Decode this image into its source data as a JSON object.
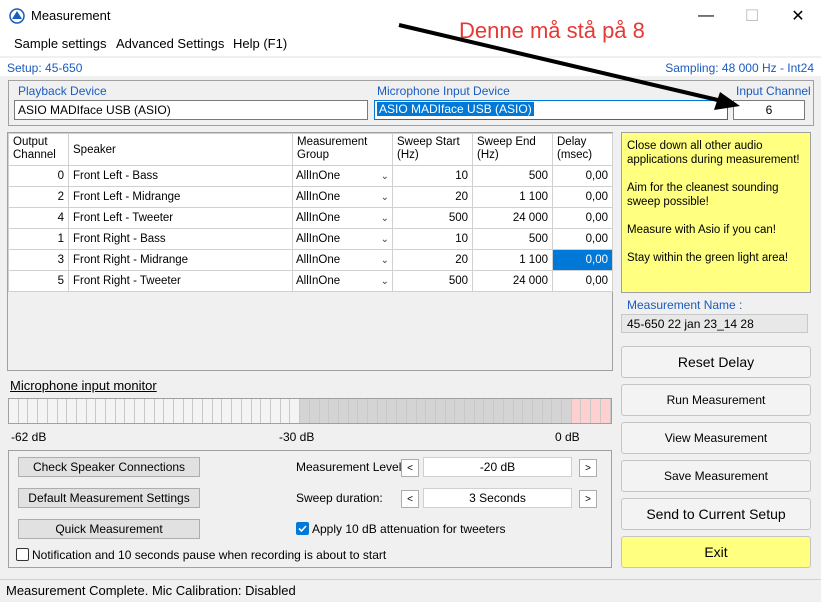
{
  "window": {
    "title": "Measurement",
    "minimize": "—",
    "maximize": "☐",
    "close": "✕"
  },
  "menu": [
    "Sample settings",
    "Advanced Settings",
    "Help (F1)"
  ],
  "setup": {
    "left": "Setup: 45-650",
    "right": "Sampling: 48 000 Hz - Int24"
  },
  "playback": {
    "label": "Playback Device",
    "value": "ASIO MADIface USB (ASIO)"
  },
  "microphone": {
    "label": "Microphone Input Device",
    "value": "ASIO MADIface USB (ASIO)"
  },
  "input_channel": {
    "label": "Input Channel",
    "value": "6"
  },
  "annotation": "Denne må stå på 8",
  "table": {
    "headers": [
      "Output\nChannel",
      "Speaker",
      "Measurement\nGroup",
      "Sweep Start\n(Hz)",
      "Sweep End\n(Hz)",
      "Delay\n(msec)"
    ],
    "rows": [
      [
        "0",
        "Front Left - Bass",
        "AllInOne",
        "10",
        "500",
        "0,00"
      ],
      [
        "2",
        "Front Left - Midrange",
        "AllInOne",
        "20",
        "1 100",
        "0,00"
      ],
      [
        "4",
        "Front Left - Tweeter",
        "AllInOne",
        "500",
        "24 000",
        "0,00"
      ],
      [
        "1",
        "Front Right - Bass",
        "AllInOne",
        "10",
        "500",
        "0,00"
      ],
      [
        "3",
        "Front Right - Midrange",
        "AllInOne",
        "20",
        "1 100",
        "0,00"
      ],
      [
        "5",
        "Front Right - Tweeter",
        "AllInOne",
        "500",
        "24 000",
        "0,00"
      ]
    ]
  },
  "tips": [
    "Close down all other audio applications during measurement!",
    "Aim for the cleanest sounding sweep possible!",
    "Measure with Asio if you can!",
    "Stay within the green light area!"
  ],
  "measurement_name": {
    "label": "Measurement Name :",
    "value": "45-650 22 jan 23_14 28"
  },
  "right_buttons": [
    "Reset Delay",
    "Run Measurement",
    "View Measurement",
    "Save Measurement",
    "Send to Current Setup",
    "Exit"
  ],
  "mic_monitor": {
    "label": "Microphone input monitor",
    "scale": [
      "-62 dB",
      "-30 dB",
      "0 dB"
    ]
  },
  "lower": {
    "buttons": [
      "Check Speaker Connections",
      "Default Measurement Settings",
      "Quick Measurement"
    ],
    "measurement_level": {
      "label": "Measurement Level:",
      "value": "-20 dB"
    },
    "sweep_duration": {
      "label": "Sweep duration:",
      "value": "3 Seconds"
    },
    "attenuation": {
      "label": "Apply 10 dB attenuation for tweeters",
      "checked": true
    },
    "notification": {
      "label": "Notification and 10 seconds pause when recording is about to start",
      "checked": false
    },
    "spin_left": "<",
    "spin_right": ">"
  },
  "status": "Measurement Complete.  Mic Calibration:  Disabled",
  "colors": {
    "yellow_panel": "#ffff80",
    "exit_button": "#ffff80",
    "selection": "#0078d7",
    "annotation": "#e53935"
  }
}
